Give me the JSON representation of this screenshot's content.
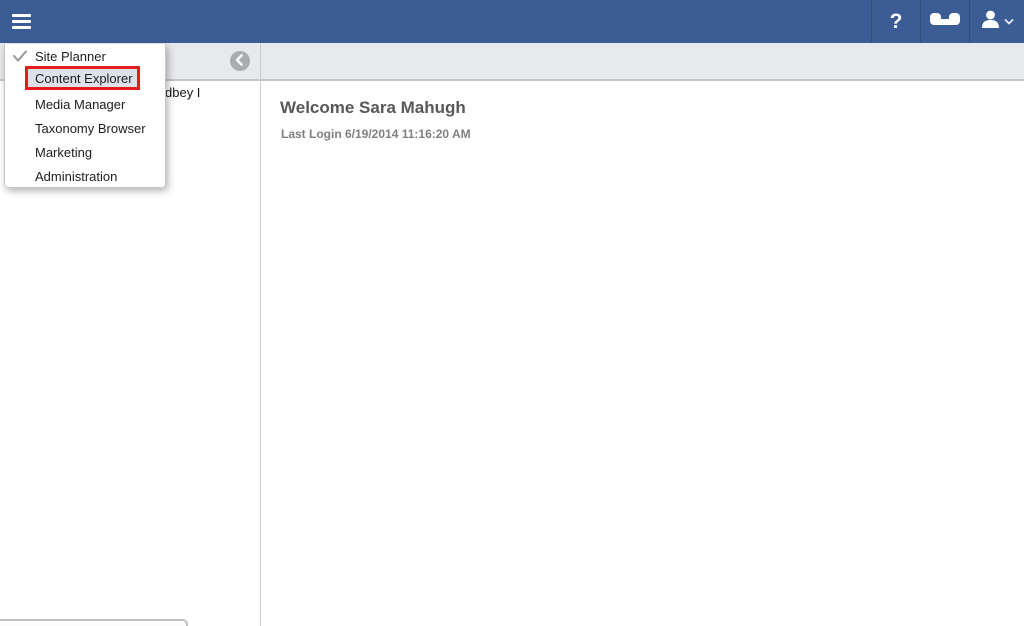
{
  "topbar": {
    "help_label": "?",
    "icons": {
      "menu": "hamburger-icon",
      "help": "question-mark-glyph",
      "support": "phone-handset-icon",
      "account": "user-icon with chevron-down"
    }
  },
  "app_menu": {
    "items": [
      {
        "label": "Site Planner",
        "checked": true,
        "highlighted": false
      },
      {
        "label": "Content Explorer",
        "checked": false,
        "highlighted": true
      },
      {
        "label": "Media Manager",
        "checked": false,
        "highlighted": false
      },
      {
        "label": "Taxonomy Browser",
        "checked": false,
        "highlighted": false
      },
      {
        "label": "Marketing",
        "checked": false,
        "highlighted": false
      },
      {
        "label": "Administration",
        "checked": false,
        "highlighted": false
      }
    ]
  },
  "toolbar": {
    "collapse_icon": "chevron-left-circle-icon"
  },
  "sidebar": {
    "partial_item_text": "dbey I"
  },
  "main": {
    "welcome_heading": "Welcome Sara Mahugh",
    "last_login": "Last Login 6/19/2014 11:16:20 AM"
  },
  "colors": {
    "topbar_bg": "#3c5c96",
    "topbar_divider": "#30507f",
    "toolbar_bg": "#e8e9eb",
    "annotation_red": "#e8191f",
    "menu_highlight_bg": "#dce2ea",
    "heading_text": "#57585a",
    "secondary_text": "#7d7f82"
  }
}
